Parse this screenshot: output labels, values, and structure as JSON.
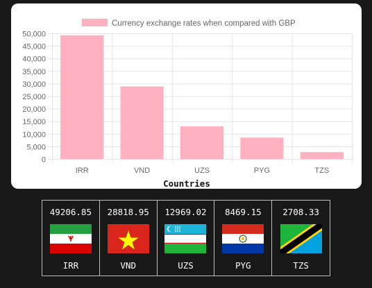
{
  "chart_data": {
    "type": "bar",
    "title": "",
    "legend": {
      "label": "Currency exchange rates when compared with GBP",
      "position": "top",
      "color": "#ffb1c1",
      "border_color": "#ff6384"
    },
    "categories": [
      "IRR",
      "VND",
      "UZS",
      "PYG",
      "TZS"
    ],
    "series": [
      {
        "name": "Currency exchange rates when compared with GBP",
        "values": [
          49206.85,
          28818.95,
          12969.02,
          8469.15,
          2708.33
        ]
      }
    ],
    "ylim": [
      0,
      50000
    ],
    "yticks": [
      0,
      5000,
      10000,
      15000,
      20000,
      25000,
      30000,
      35000,
      40000,
      45000,
      50000
    ],
    "ytick_labels": [
      "0",
      "5,000",
      "10,000",
      "15,000",
      "20,000",
      "25,000",
      "30,000",
      "35,000",
      "40,000",
      "45,000",
      "50,000"
    ],
    "xlabel": "Countries",
    "ylabel": "",
    "grid": true
  },
  "currency_cards": [
    {
      "code": "IRR",
      "rate": "49206.85",
      "flag_icon": "iran-flag-icon"
    },
    {
      "code": "VND",
      "rate": "28818.95",
      "flag_icon": "vietnam-flag-icon"
    },
    {
      "code": "UZS",
      "rate": "12969.02",
      "flag_icon": "uzbekistan-flag-icon"
    },
    {
      "code": "PYG",
      "rate": "8469.15",
      "flag_icon": "paraguay-flag-icon"
    },
    {
      "code": "TZS",
      "rate": "2708.33",
      "flag_icon": "tanzania-flag-icon"
    }
  ],
  "colors": {
    "page_background": "#181818",
    "card_background": "#ffffff",
    "bar_fill": "#ffb1c1",
    "grid": "#e5e5e5",
    "text_muted": "#666666"
  }
}
